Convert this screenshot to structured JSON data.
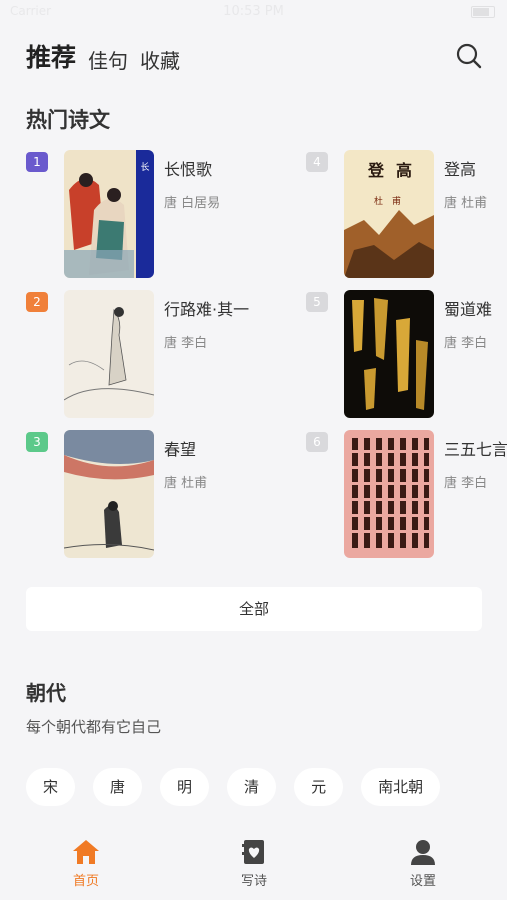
{
  "status_bar": {
    "carrier": "Carrier",
    "time": "10:53 PM"
  },
  "header": {
    "tabs": [
      {
        "label": "推荐",
        "active": true
      },
      {
        "label": "佳句",
        "active": false
      },
      {
        "label": "收藏",
        "active": false
      }
    ],
    "search_icon": "search-icon"
  },
  "hot": {
    "title": "热门诗文",
    "items": [
      {
        "rank": "1",
        "title": "长恨歌",
        "author": "唐  白居易",
        "rank_color": "#6a5acd"
      },
      {
        "rank": "4",
        "title": "登高",
        "author": "唐  杜甫",
        "rank_color": "#d9d9dc"
      },
      {
        "rank": "2",
        "title": "行路难·其一",
        "author": "唐  李白",
        "rank_color": "#f0803a"
      },
      {
        "rank": "5",
        "title": "蜀道难",
        "author": "唐  李白",
        "rank_color": "#d9d9dc"
      },
      {
        "rank": "3",
        "title": "春望",
        "author": "唐  杜甫",
        "rank_color": "#5cc98a"
      },
      {
        "rank": "6",
        "title": "三五七言",
        "author": "唐  李白",
        "rank_color": "#d9d9dc"
      }
    ],
    "all_label": "全部"
  },
  "dynasty": {
    "title": "朝代",
    "subtitle": "每个朝代都有它自己",
    "items": [
      "宋",
      "唐",
      "明",
      "清",
      "元",
      "南北朝"
    ]
  },
  "nav": [
    {
      "label": "首页",
      "icon": "home-icon",
      "active": true
    },
    {
      "label": "写诗",
      "icon": "write-icon",
      "active": false
    },
    {
      "label": "设置",
      "icon": "user-icon",
      "active": false
    }
  ],
  "colors": {
    "accent": "#f07a25",
    "background": "#f5f5f7"
  }
}
